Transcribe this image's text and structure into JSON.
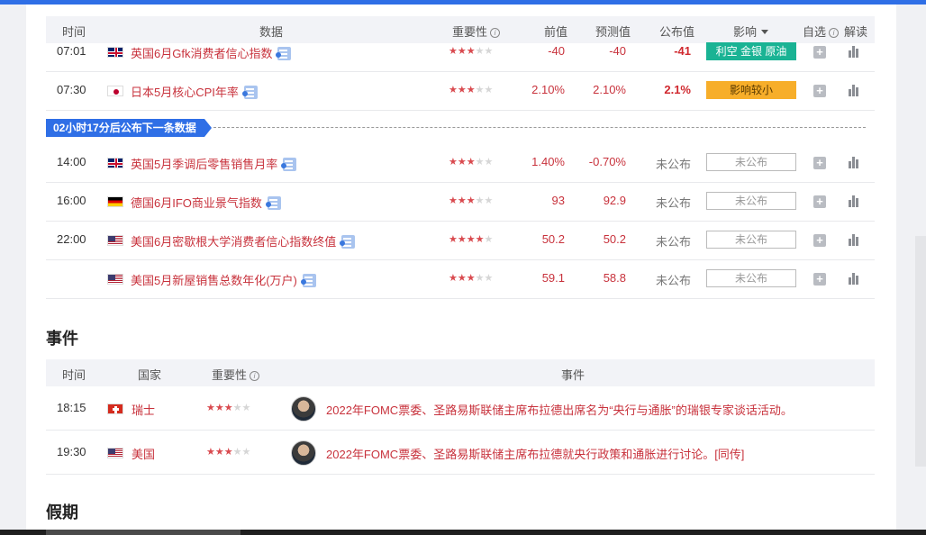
{
  "header": {
    "time": "时间",
    "data": "数据",
    "importance": "重要性",
    "previous": "前值",
    "forecast": "预测值",
    "actual": "公布值",
    "impact": "影响",
    "watch": "自选",
    "interpret": "解读"
  },
  "rows": [
    {
      "time": "07:01",
      "flag": "uk",
      "name": "英国6月Gfk消费者信心指数",
      "stars": 3,
      "previous": "-40",
      "forecast": "-40",
      "actual": "-41",
      "impact": "利空 金银 原油",
      "impact_style": "green"
    },
    {
      "time": "07:30",
      "flag": "jp",
      "name": "日本5月核心CPI年率",
      "stars": 3,
      "previous": "2.10%",
      "forecast": "2.10%",
      "actual": "2.1%",
      "impact": "影响较小",
      "impact_style": "orange"
    },
    {
      "time": "14:00",
      "flag": "uk",
      "name": "英国5月季调后零售销售月率",
      "stars": 3,
      "previous": "1.40%",
      "forecast": "-0.70%",
      "actual": "未公布",
      "impact": "未公布",
      "impact_style": "empty"
    },
    {
      "time": "16:00",
      "flag": "de",
      "name": "德国6月IFO商业景气指数",
      "stars": 3,
      "previous": "93",
      "forecast": "92.9",
      "actual": "未公布",
      "impact": "未公布",
      "impact_style": "empty"
    },
    {
      "time": "22:00",
      "flag": "us",
      "name": "美国6月密歇根大学消费者信心指数终值",
      "stars": 4,
      "previous": "50.2",
      "forecast": "50.2",
      "actual": "未公布",
      "impact": "未公布",
      "impact_style": "empty"
    },
    {
      "time": "",
      "flag": "us",
      "name": "美国5月新屋销售总数年化(万户)",
      "stars": 3,
      "previous": "59.1",
      "forecast": "58.8",
      "actual": "未公布",
      "impact": "未公布",
      "impact_style": "empty"
    }
  ],
  "banner": "02小时17分后公布下一条数据",
  "events_section": {
    "title": "事件",
    "header": {
      "time": "时间",
      "country": "国家",
      "importance": "重要性",
      "event": "事件"
    },
    "rows": [
      {
        "time": "18:15",
        "flag": "ch",
        "country": "瑞士",
        "stars": 3,
        "text": "2022年FOMC票委、圣路易斯联储主席布拉德出席名为“央行与通胀”的瑞银专家谈话活动。"
      },
      {
        "time": "19:30",
        "flag": "us",
        "country": "美国",
        "stars": 3,
        "text": "2022年FOMC票委、圣路易斯联储主席布拉德就央行政策和通胀进行讨论。[同传]"
      }
    ]
  },
  "holiday_section": {
    "title": "假期"
  },
  "colors": {
    "accent": "#2f6fe6",
    "red": "#c8323c",
    "green": "#1ab394",
    "orange": "#f7ae2a"
  }
}
